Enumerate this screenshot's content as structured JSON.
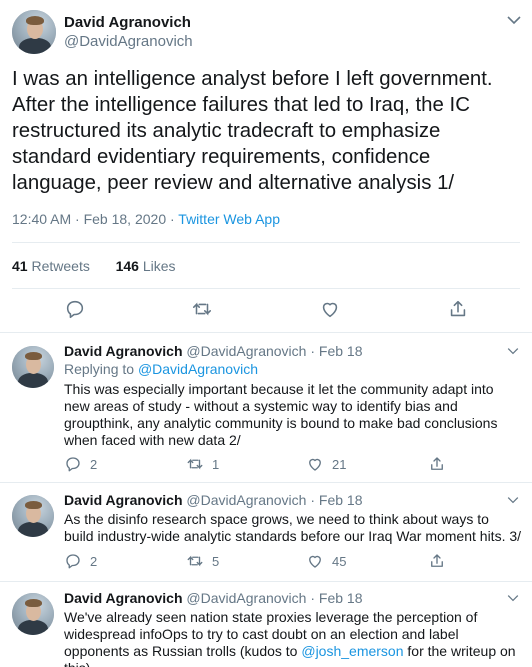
{
  "main_tweet": {
    "name": "David Agranovich",
    "handle": "@DavidAgranovich",
    "text": "I was an intelligence analyst before I left government. After the intelligence failures that led to Iraq, the IC restructured its analytic tradecraft to emphasize standard evidentiary requirements, confidence language, peer review and alternative analysis 1/",
    "timestamp": "12:40 AM · Feb 18, 2020 · ",
    "app": "Twitter Web App",
    "retweets_count": "41",
    "retweets_label": "Retweets",
    "likes_count": "146",
    "likes_label": "Likes"
  },
  "replies": [
    {
      "name": "David Agranovich",
      "handle": "@DavidAgranovich · Feb 18",
      "replying_prefix": "Replying to ",
      "replying_to": "@DavidAgranovich",
      "text": "This was especially important because it let the community adapt into new areas of study - without a systemic way to identify bias and groupthink, any analytic community is bound to make bad conclusions when faced with new data 2/",
      "reply_count": "2",
      "retweet_count": "1",
      "like_count": "21"
    },
    {
      "name": "David Agranovich",
      "handle": "@DavidAgranovich · Feb 18",
      "text": "As the disinfo research space grows, we need to think about ways to build industry-wide analytic standards before our Iraq War moment hits. 3/",
      "reply_count": "2",
      "retweet_count": "5",
      "like_count": "45"
    },
    {
      "name": "David Agranovich",
      "handle": "@DavidAgranovich · Feb 18",
      "text_before": "We've already seen nation state proxies leverage the perception of widespread infoOps to try to cast doubt on an election and label opponents as Russian trolls (kudos to ",
      "mention": "@josh_emerson",
      "text_after": " for the writeup on this)"
    }
  ],
  "colors": {
    "accent": "#1b95e0",
    "secondary_text": "#657786",
    "divider": "#e6ecf0"
  },
  "icons": [
    "reply-icon",
    "retweet-icon",
    "like-icon",
    "share-icon",
    "chevron-down-icon"
  ]
}
